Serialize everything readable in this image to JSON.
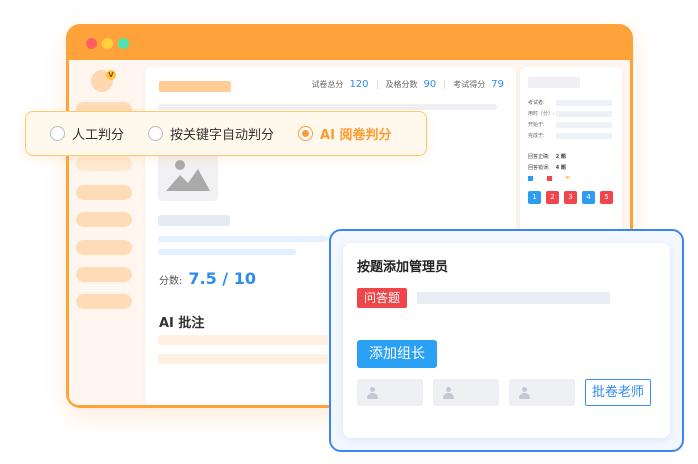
{
  "window": {
    "avatar_badge": "V"
  },
  "exam_header": {
    "total_label": "试卷总分",
    "total_value": "120",
    "pass_label": "及格分数",
    "pass_value": "90",
    "score_label": "考试得分",
    "score_value": "79"
  },
  "result": {
    "score_label": "分数:",
    "score_value": "7.5 / 10",
    "ai_comment_title": "AI 批注"
  },
  "right_panel": {
    "fields": [
      "考试者:",
      "用时（分）:",
      "开始于:",
      "完成于:"
    ],
    "correct_label": "回答正确:",
    "correct_value": "2 题",
    "wrong_label": "回答错误:",
    "wrong_value": "4 题",
    "questions": [
      "1",
      "2",
      "3",
      "4",
      "5"
    ],
    "colors": {
      "correct": "#2e9cf0",
      "wrong": "#f0454a",
      "flag": "#ffc53d"
    }
  },
  "grading_modes": {
    "options": [
      "人工判分",
      "按关键字自动判分",
      "AI 阅卷判分"
    ],
    "selected": "AI 阅卷判分"
  },
  "admin_card": {
    "title": "按题添加管理员",
    "question_type": "问答题",
    "add_leader_button": "添加组长",
    "teacher_button": "批卷老师"
  },
  "colors": {
    "brand_orange": "#ffa23a",
    "accent_blue": "#2e8cf0",
    "tag_red": "#f0454a"
  }
}
